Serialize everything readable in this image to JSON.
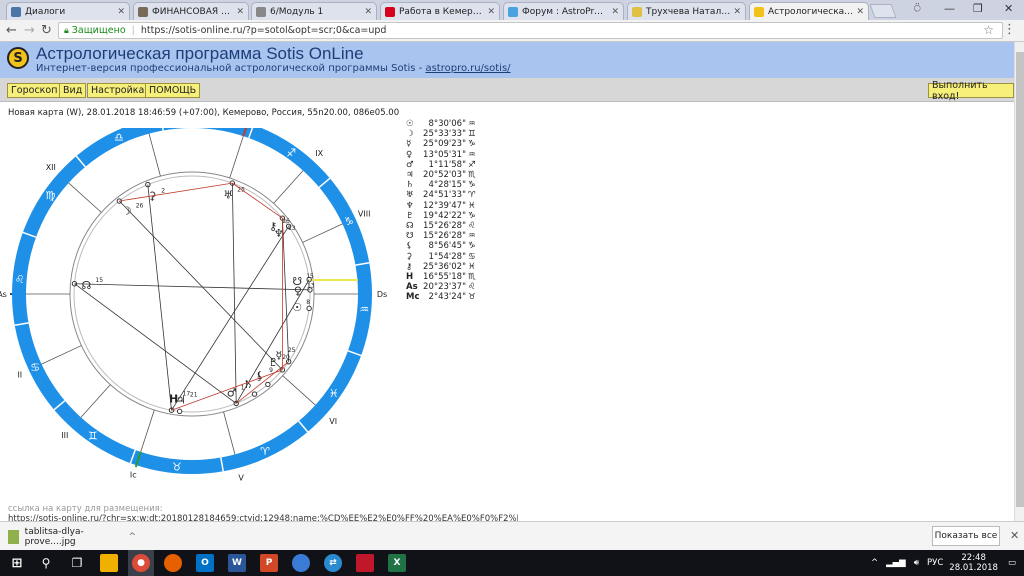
{
  "browser": {
    "tabs": [
      {
        "title": "Диалоги",
        "icon": "vk-icon",
        "color": "#4a76a8",
        "active": false
      },
      {
        "title": "ФИНАНСОВАЯ ЕМКОСТ",
        "icon": "finance-icon",
        "color": "#7a6a5a",
        "active": false
      },
      {
        "title": "6/Модуль 1",
        "icon": "doc-icon",
        "color": "#888888",
        "active": false
      },
      {
        "title": "Работа в Кемерове, вак",
        "icon": "hh-icon",
        "color": "#d6001c",
        "active": false
      },
      {
        "title": "Форум : AstroPro - проф",
        "icon": "forum-icon",
        "color": "#4aa3df",
        "active": false
      },
      {
        "title": "Трухчева Наталла (Кем",
        "icon": "star-icon",
        "color": "#e0c040",
        "active": false
      },
      {
        "title": "Астрологическая програ",
        "icon": "sotis-icon",
        "color": "#f3c21a",
        "active": true
      }
    ],
    "secure_label": "Защищено",
    "url": "https://sotis-online.ru/?p=sotol&opt=scr;0&ca=upd"
  },
  "site": {
    "title": "Астрологическая программа Sotis OnLine",
    "subtitle": "Интернет-версия профессиональной астрологической программы Sotis - ",
    "subtitle_link": "astropro.ru/sotis/"
  },
  "menu": {
    "horoscope": "Гороскоп",
    "view": "Вид",
    "settings": "Настройка",
    "help": "ПОМОЩЬ",
    "login": "Выполнить вход!"
  },
  "chart_title": "Новая карта (W), 28.01.2018 18:46:59 (+07:00), Кемерово, Россия, 55n20.00, 086e05.00",
  "planets": [
    {
      "symbol": "☉",
      "value": "8°30'06\"",
      "sign": "♒"
    },
    {
      "symbol": "☽",
      "value": "25°33'33\"",
      "sign": "♊"
    },
    {
      "symbol": "☿",
      "value": "25°09'23\"",
      "sign": "♑"
    },
    {
      "symbol": "♀",
      "value": "13°05'31\"",
      "sign": "♒"
    },
    {
      "symbol": "♂",
      "value": "1°11'58\"",
      "sign": "♐"
    },
    {
      "symbol": "♃",
      "value": "20°52'03\"",
      "sign": "♏"
    },
    {
      "symbol": "♄",
      "value": "4°28'15\"",
      "sign": "♑"
    },
    {
      "symbol": "♅",
      "value": "24°51'33\"",
      "sign": "♈"
    },
    {
      "symbol": "♆",
      "value": "12°39'47\"",
      "sign": "♓"
    },
    {
      "symbol": "♇",
      "value": "19°42'22\"",
      "sign": "♑"
    },
    {
      "symbol": "☊",
      "value": "15°26'28\"",
      "sign": "♌"
    },
    {
      "symbol": "☋",
      "value": "15°26'28\"",
      "sign": "♒"
    },
    {
      "symbol": "⚸",
      "value": "8°56'45\"",
      "sign": "♑"
    },
    {
      "symbol": "⚳",
      "value": "1°54'28\"",
      "sign": "♋"
    },
    {
      "symbol": "⚷",
      "value": "25°36'02\"",
      "sign": "♓"
    },
    {
      "symbol": "H",
      "value": "16°55'18\"",
      "sign": "♏"
    },
    {
      "symbol": "As",
      "value": "20°23'37\"",
      "sign": "♌"
    },
    {
      "symbol": "Mc",
      "value": "2°43'24\"",
      "sign": "♉"
    }
  ],
  "chart": {
    "house_labels": [
      "As",
      "II",
      "III",
      "Ic",
      "V",
      "VI",
      "Ds",
      "VIII",
      "IX",
      "Mc",
      "XI",
      "XII"
    ],
    "house_degrees": [
      "21",
      "",
      "",
      "3",
      "15",
      "22",
      "21",
      "",
      "",
      "3",
      "",
      "22"
    ],
    "ring_signs": [
      "♌",
      "♋",
      "♊",
      "♉",
      "♈",
      "♓",
      "♒",
      "♑",
      "♐",
      "♏",
      "♎",
      "♍"
    ],
    "placements": [
      {
        "glyph": "☽",
        "deg": "26"
      },
      {
        "glyph": "⚳",
        "deg": "2"
      },
      {
        "glyph": "♅",
        "deg": "25"
      },
      {
        "glyph": "⚷",
        "deg": "26"
      },
      {
        "glyph": "♆",
        "deg": "13"
      },
      {
        "glyph": "☋",
        "deg": "15"
      },
      {
        "glyph": "♀",
        "deg": "13"
      },
      {
        "glyph": "☉",
        "deg": "8"
      },
      {
        "glyph": "☿",
        "deg": "25"
      },
      {
        "glyph": "♇",
        "deg": "20"
      },
      {
        "glyph": "⚸",
        "deg": "9"
      },
      {
        "glyph": "♄",
        "deg": "5"
      },
      {
        "glyph": "♂",
        "deg": "1"
      },
      {
        "glyph": "H",
        "deg": "17"
      },
      {
        "glyph": "♃",
        "deg": "21"
      },
      {
        "glyph": "☊",
        "deg": "15"
      }
    ]
  },
  "link_label": "ссылка на карту для размещения:",
  "link_url": "https://sotis-online.ru/?chr=sx;w;dt:20180128184659;ctyid:12948;name:%CD%EE%E2%E0%FF%20%EA%E0%F0%F2%E0;opt=scr;0",
  "download": {
    "filename": "tablitsa-dlya-prove....jpg",
    "show_all": "Показать все"
  },
  "taskbar": {
    "lang": "РУС",
    "time": "22:48",
    "date": "28.01.2018"
  },
  "colors": {
    "ring": "#1e90e8",
    "header": "#a9c4ee",
    "buttons": "#f6ef7a"
  }
}
